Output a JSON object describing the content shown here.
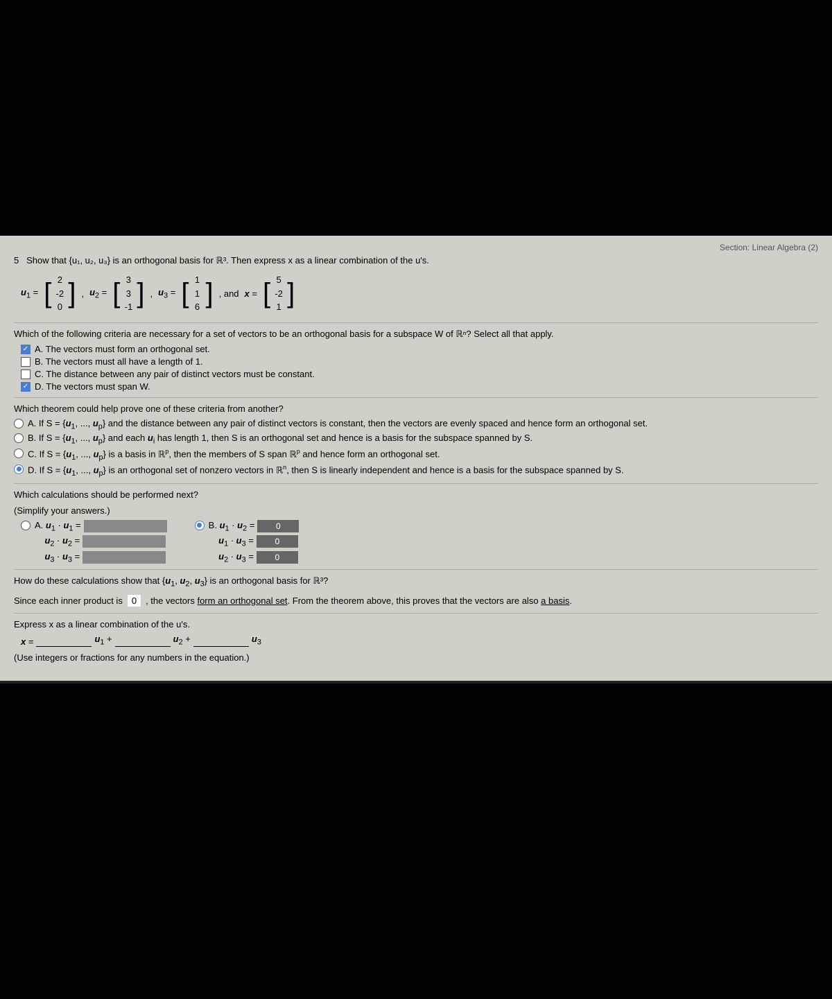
{
  "page": {
    "top_label": "Section: Linear Algebra (2)",
    "problem_number": "5",
    "problem_statement": "Show that {u₁, u₂, u₃} is an orthogonal basis for ℝ³. Then express x as a linear combination of the u's.",
    "vectors": {
      "u1": [
        "2",
        "-2",
        "0"
      ],
      "u2": [
        "3",
        "3",
        "-1"
      ],
      "u3": [
        "1",
        "1",
        "6"
      ],
      "x": [
        "5",
        "-2",
        "1"
      ]
    },
    "question1": {
      "text": "Which of the following criteria are necessary for a set of vectors to be an orthogonal basis for a subspace W of ℝⁿ? Select all that apply.",
      "options": [
        {
          "id": "A",
          "checked": true,
          "text": "The vectors must form an orthogonal set."
        },
        {
          "id": "B",
          "checked": false,
          "text": "The vectors must all have a length of 1."
        },
        {
          "id": "C",
          "checked": false,
          "text": "The distance between any pair of distinct vectors must be constant."
        },
        {
          "id": "D",
          "checked": true,
          "text": "The vectors must span W."
        }
      ]
    },
    "question2": {
      "text": "Which theorem could help prove one of these criteria from another?",
      "options": [
        {
          "id": "A",
          "selected": false,
          "text": "If S = {u₁, ..., uₚ} and the distance between any pair of distinct vectors is constant, then the vectors are evenly spaced and hence form an orthogonal set."
        },
        {
          "id": "B",
          "selected": false,
          "text": "If S = {u₁, ..., uₚ} and each uᵢ has length 1, then S is an orthogonal set and hence is a basis for the subspace spanned by S."
        },
        {
          "id": "C",
          "selected": false,
          "text": "If S = {u₁, ..., uₚ} is a basis in ℝᵖ, then the members of S span ℝᵖ and hence form an orthogonal set."
        },
        {
          "id": "D",
          "selected": true,
          "text": "If S = {u₁, ..., uₚ} is an orthogonal set of nonzero vectors in ℝⁿ, then S is linearly independent and hence is a basis for the subspace spanned by S."
        }
      ]
    },
    "question3": {
      "text": "Which calculations should be performed next?",
      "subtext": "(Simplify your answers.)",
      "options": [
        {
          "id": "A",
          "selected": false,
          "left_calcs": [
            "u₁ · u₁ =",
            "u₂ · u₂ =",
            "u₃ · u₃ ="
          ]
        },
        {
          "id": "B",
          "selected": true,
          "right_calcs": [
            {
              "label": "u₁ · u₂ =",
              "value": "0"
            },
            {
              "label": "u₁ · u₃ =",
              "value": "0"
            },
            {
              "label": "u₂ · u₃ =",
              "value": "0"
            }
          ]
        }
      ]
    },
    "question4": {
      "text": "How do these calculations show that {u₁, u₂, u₃} is an orthogonal basis for ℝ³?",
      "answer_line": "Since each inner product is",
      "answer_value": "0",
      "answer_continuation": ", the vectors form an orthogonal set. From the theorem above, this proves that the vectors are also a basis."
    },
    "question5": {
      "text": "Express x as a linear combination of the u's.",
      "equation": "x = _____ u₁ + _____ u₂ + _____ u₃",
      "note": "(Use integers or fractions for any numbers in the equation.)"
    }
  }
}
